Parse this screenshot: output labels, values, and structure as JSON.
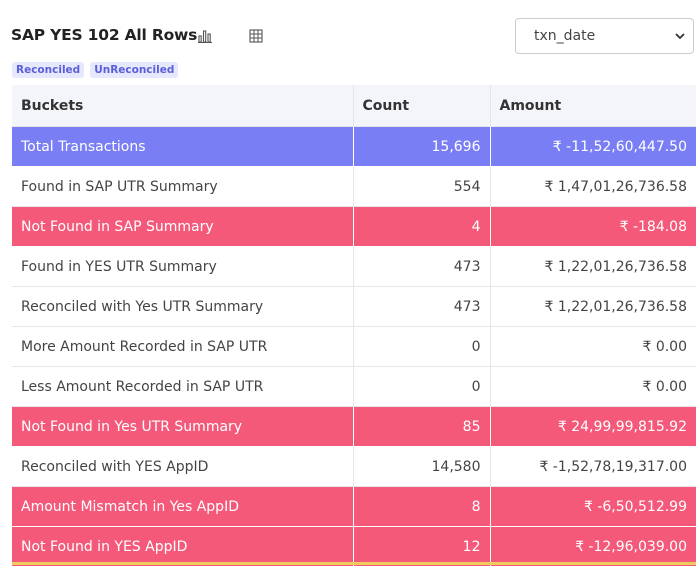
{
  "header": {
    "title": "SAP YES 102 All Rows",
    "chart_icon": "bar-chart-icon",
    "table_icon": "table-grid-icon",
    "select_value": "txn_date"
  },
  "tags": [
    "Reconciled",
    "UnReconciled"
  ],
  "table": {
    "columns": [
      "Buckets",
      "Count",
      "Amount"
    ],
    "rows": [
      {
        "bucket": "Total Transactions",
        "count": "15,696",
        "amount": "₹ -11,52,60,447.50",
        "status": "total"
      },
      {
        "bucket": "Found in SAP UTR Summary",
        "count": "554",
        "amount": "₹ 1,47,01,26,736.58",
        "status": "normal"
      },
      {
        "bucket": "Not Found in SAP Summary",
        "count": "4",
        "amount": "₹ -184.08",
        "status": "alert"
      },
      {
        "bucket": "Found in YES UTR Summary",
        "count": "473",
        "amount": "₹ 1,22,01,26,736.58",
        "status": "normal"
      },
      {
        "bucket": "Reconciled with Yes UTR Summary",
        "count": "473",
        "amount": "₹ 1,22,01,26,736.58",
        "status": "normal"
      },
      {
        "bucket": "More Amount Recorded in SAP UTR",
        "count": "0",
        "amount": "₹ 0.00",
        "status": "normal"
      },
      {
        "bucket": "Less Amount Recorded in SAP UTR",
        "count": "0",
        "amount": "₹ 0.00",
        "status": "normal"
      },
      {
        "bucket": "Not Found in Yes UTR Summary",
        "count": "85",
        "amount": "₹ 24,99,99,815.92",
        "status": "alert"
      },
      {
        "bucket": "Reconciled with YES AppID",
        "count": "14,580",
        "amount": "₹ -1,52,78,19,317.00",
        "status": "normal"
      },
      {
        "bucket": "Amount Mismatch in Yes AppID",
        "count": "8",
        "amount": "₹ -6,50,512.99",
        "status": "alert"
      },
      {
        "bucket": "Not Found in YES AppID",
        "count": "12",
        "amount": "₹ -12,96,039.00",
        "status": "alert"
      }
    ]
  },
  "colors": {
    "total_row": "#7a7ef5",
    "alert_row": "#f4597a",
    "tag_bg": "#e6e8fd",
    "tag_text": "#5a5fd9",
    "bottom_accent": "#f0cc5e"
  }
}
